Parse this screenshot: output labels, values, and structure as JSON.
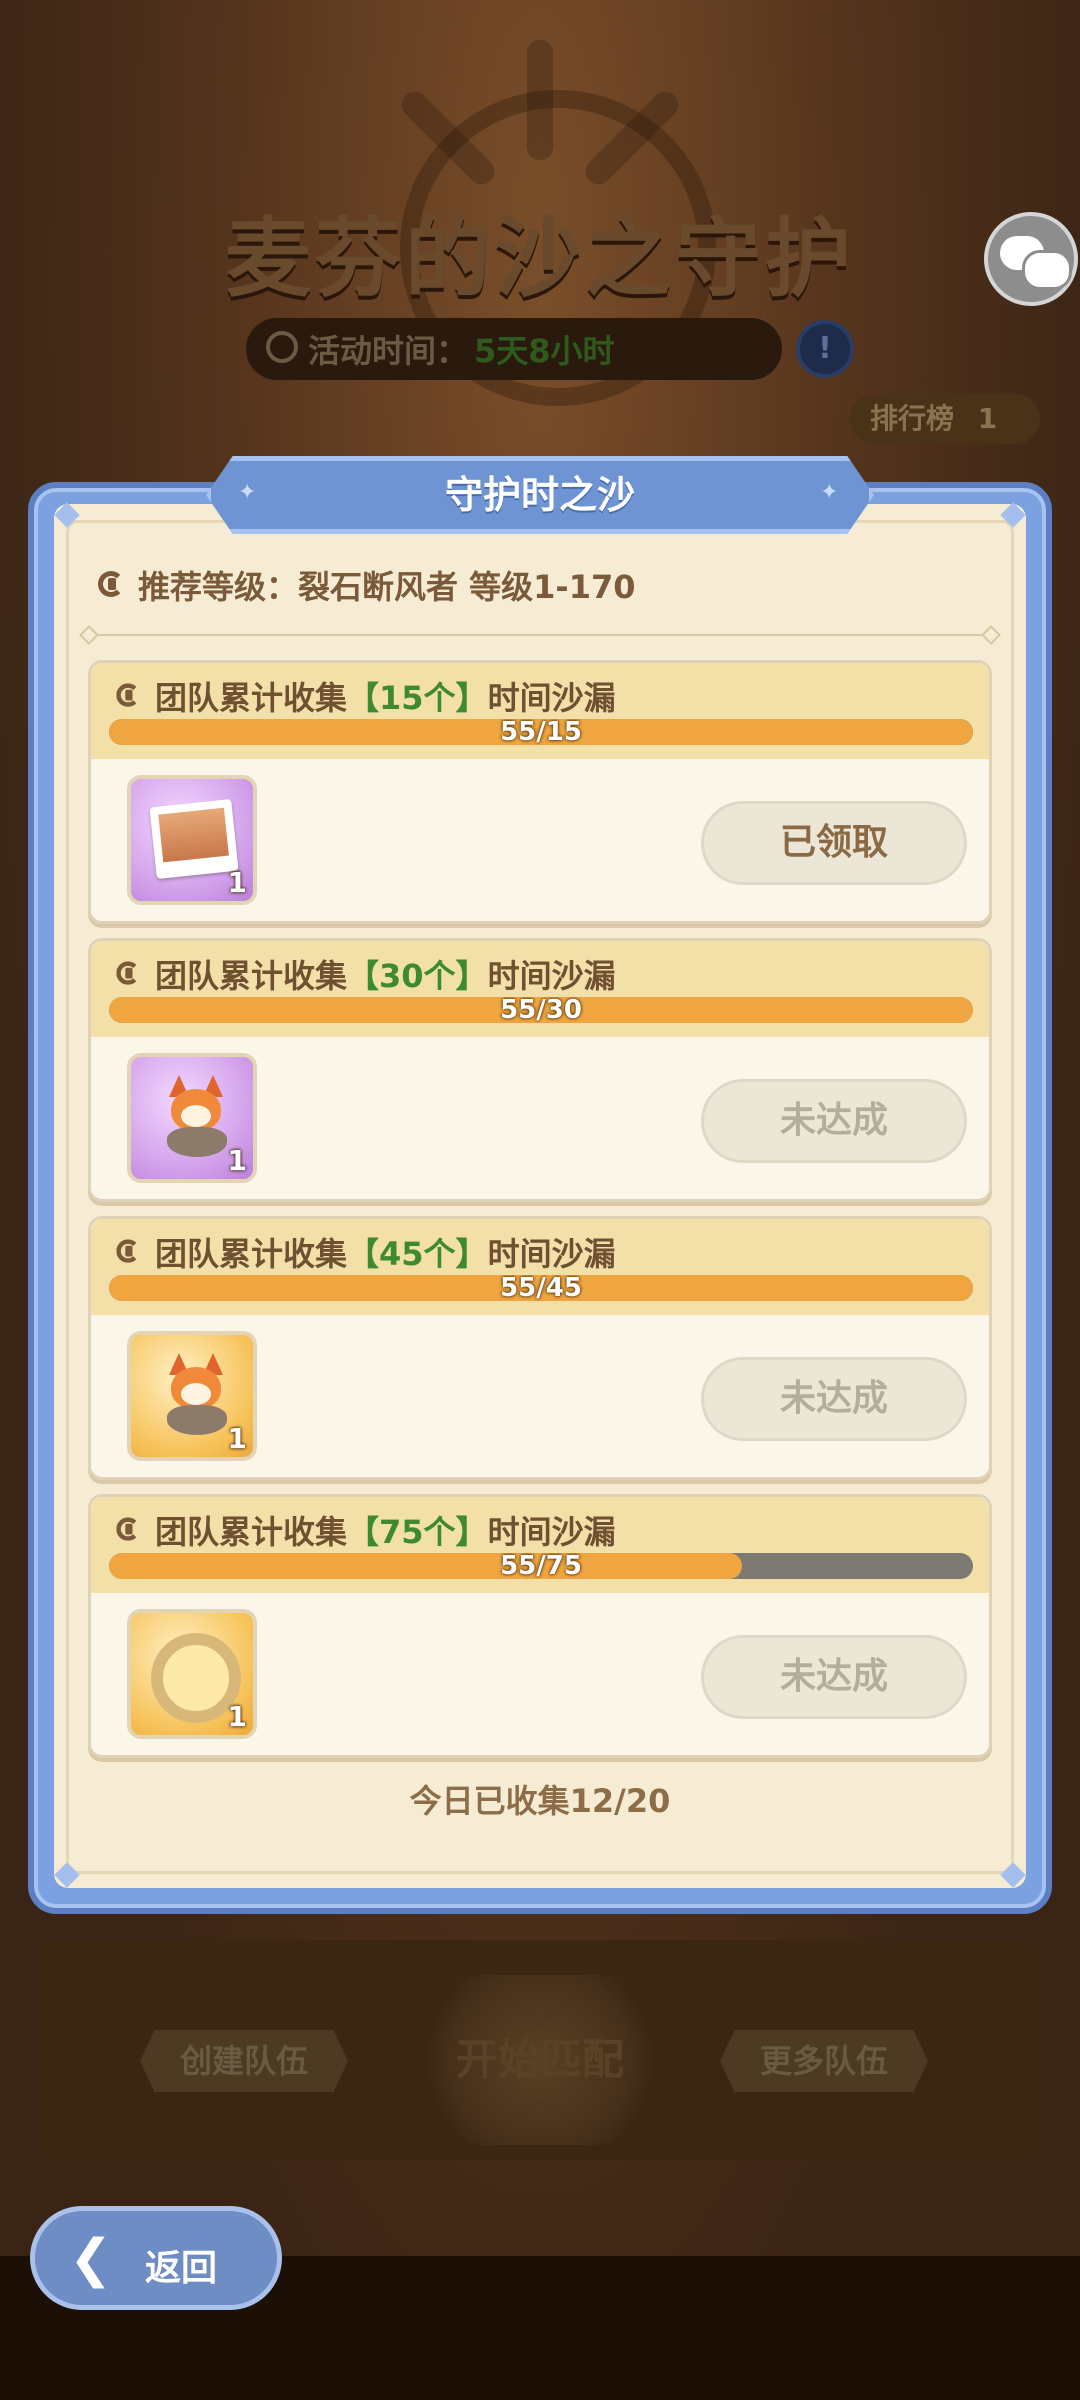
{
  "background": {
    "event_title": "麦芬的沙之守护",
    "activity_time_label": "活动时间：",
    "activity_time_value": "5天8小时",
    "info_badge": "!",
    "ranking_label": "排行榜",
    "ranking_count": "1",
    "buttons": {
      "create_team": "创建队伍",
      "start_match": "开始匹配",
      "more_teams": "更多队伍"
    }
  },
  "modal": {
    "title": "守护时之沙",
    "recommend_label": "推荐等级：",
    "recommend_value": "裂石断风者  等级1-170",
    "daily_collected": "今日已收集12/20",
    "tasks": [
      {
        "prefix": "团队累计收集",
        "count": "【15个】",
        "suffix": "时间沙漏",
        "progress_text": "55/15",
        "progress": 1.0,
        "reward_qty": "1",
        "reward_icon": "desert-photo-icon",
        "status": "已领取"
      },
      {
        "prefix": "团队累计收集",
        "count": "【30个】",
        "suffix": "时间沙漏",
        "progress_text": "55/30",
        "progress": 1.0,
        "reward_qty": "1",
        "reward_icon": "fox-avatar-icon",
        "status": "未达成"
      },
      {
        "prefix": "团队累计收集",
        "count": "【45个】",
        "suffix": "时间沙漏",
        "progress_text": "55/45",
        "progress": 1.0,
        "reward_qty": "1",
        "reward_icon": "fox-avatar-icon",
        "status": "未达成"
      },
      {
        "prefix": "团队累计收集",
        "count": "【75个】",
        "suffix": "时间沙漏",
        "progress_text": "55/75",
        "progress": 0.733,
        "reward_qty": "1",
        "reward_icon": "avatar-frame-icon",
        "status": "未达成"
      }
    ]
  },
  "back_button": "返回",
  "colors": {
    "frame_blue": "#7ba1e0",
    "progress_orange": "#f0a640",
    "count_green": "#3e8a2e",
    "panel_cream": "#f6ecd4"
  }
}
